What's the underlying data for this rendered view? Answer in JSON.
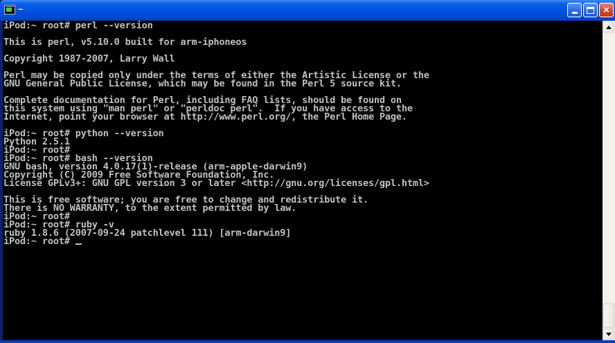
{
  "window": {
    "title": "~",
    "controls": {
      "minimize": "minimize",
      "maximize": "maximize",
      "close": "×"
    }
  },
  "console": {
    "lines": [
      "iPod:~ root# perl --version",
      "",
      "This is perl, v5.10.0 built for arm-iphoneos",
      "",
      "Copyright 1987-2007, Larry Wall",
      "",
      "Perl may be copied only under the terms of either the Artistic License or the",
      "GNU General Public License, which may be found in the Perl 5 source kit.",
      "",
      "Complete documentation for Perl, including FAQ lists, should be found on",
      "this system using \"man perl\" or \"perldoc perl\".  If you have access to the",
      "Internet, point your browser at http://www.perl.org/, the Perl Home Page.",
      "",
      "iPod:~ root# python --version",
      "Python 2.5.1",
      "iPod:~ root#",
      "iPod:~ root# bash --version",
      "GNU bash, version 4.0.17(1)-release (arm-apple-darwin9)",
      "Copyright (C) 2009 Free Software Foundation, Inc.",
      "License GPLv3+: GNU GPL version 3 or later <http://gnu.org/licenses/gpl.html>",
      "",
      "This is free software; you are free to change and redistribute it.",
      "There is NO WARRANTY, to the extent permitted by law.",
      "iPod:~ root#",
      "iPod:~ root# ruby -v",
      "ruby 1.8.6 (2007-09-24 patchlevel 111) [arm-darwin9]"
    ],
    "prompt": "iPod:~ root# "
  },
  "colors": {
    "console_bg": "#000000",
    "console_fg": "#c0c0c0",
    "titlebar": "#0055e5",
    "close_button": "#d44a2a"
  }
}
